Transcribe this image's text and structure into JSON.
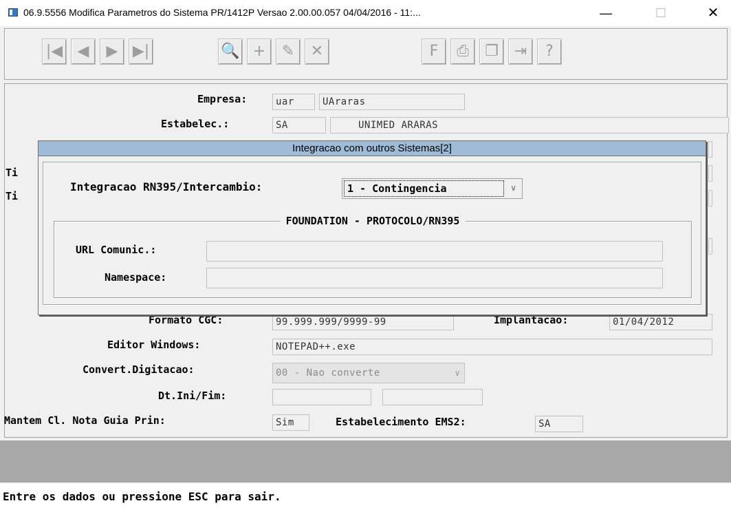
{
  "window": {
    "title": "06.9.5556  Modifica  Parametros do Sistema PR/1412P Versao 2.00.00.057 04/04/2016 - 11:...",
    "minimize": "—",
    "maximize": "☐",
    "close": "✕"
  },
  "toolbar": {
    "first": "|◀",
    "prev": "◀",
    "next": "▶",
    "last": "▶|",
    "search": "🔍",
    "add": "+",
    "edit": "✎",
    "delete": "✕",
    "filter": "F",
    "print": "⎙",
    "copy": "❐",
    "exit": "⇥",
    "help": "?"
  },
  "form": {
    "empresa_label": "Empresa:",
    "empresa_code": "uar",
    "empresa_name": "UAraras",
    "estab_label": "Estabelec.:",
    "estab_code": "SA",
    "estab_name": "UNIMED ARARAS",
    "ti1_label": "Ti",
    "ti2_label": "Ti",
    "formato_label": "Formato CGC:",
    "formato_value": "99.999.999/9999-99",
    "implantacao_label": "Implantacao:",
    "implantacao_value": "01/04/2012",
    "editor_label": "Editor Windows:",
    "editor_value": "NOTEPAD++.exe",
    "convert_label": "Convert.Digitacao:",
    "convert_value": "00 - Nao converte",
    "dtini_label": "Dt.Ini/Fim:",
    "mantem_label": "Mantem Cl. Nota Guia Prin:",
    "mantem_value": "Sim",
    "estab_ems2_label": "Estabelecimento EMS2:",
    "estab_ems2_value": "SA"
  },
  "dialog": {
    "title": "Integracao com outros Sistemas[2]",
    "integracao_label": "Integracao RN395/Intercambio:",
    "integracao_value": "1 - Contingencia",
    "group_title": "FOUNDATION - PROTOCOLO/RN395",
    "url_label": "URL Comunic.:",
    "url_value": "",
    "namespace_label": "Namespace:",
    "namespace_value": ""
  },
  "status": {
    "message": "Entre os dados ou pressione ESC para sair."
  }
}
